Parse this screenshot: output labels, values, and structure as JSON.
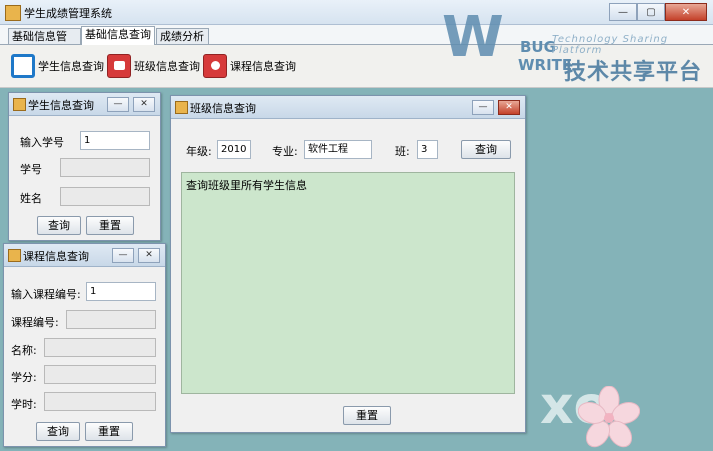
{
  "window": {
    "title": "学生成绩管理系统"
  },
  "logo": {
    "letters": "W",
    "bug": "BUG",
    "write": "WRITE",
    "tagline": "Technology Sharing Platform",
    "cn": "技术共享平台"
  },
  "tabs": [
    "基础信息管理",
    "基础信息查询",
    "成绩分析"
  ],
  "toolbar": {
    "student_query": "学生信息查询",
    "class_query": "班级信息查询",
    "course_query": "课程信息查询"
  },
  "student_frame": {
    "title": "学生信息查询",
    "input_label": "输入学号",
    "input_value": "1",
    "id_label": "学号",
    "name_label": "姓名",
    "query_btn": "查询",
    "reset_btn": "重置"
  },
  "course_frame": {
    "title": "课程信息查询",
    "input_label": "输入课程编号:",
    "input_value": "1",
    "code_label": "课程编号:",
    "name_label": "名称:",
    "credit_label": "学分:",
    "hours_label": "学时:",
    "query_btn": "查询",
    "reset_btn": "重置"
  },
  "class_frame": {
    "title": "班级信息查询",
    "grade_label": "年级:",
    "grade_value": "2010",
    "major_label": "专业:",
    "major_value": "软件工程",
    "class_label": "班:",
    "class_value": "3",
    "query_btn": "查询",
    "result_text": "查询班级里所有学生信息",
    "reset_btn": "重置"
  },
  "desktop_deco": "xo",
  "colors": {
    "desktop": "#84b3b8",
    "result_bg": "#cce6cc"
  }
}
